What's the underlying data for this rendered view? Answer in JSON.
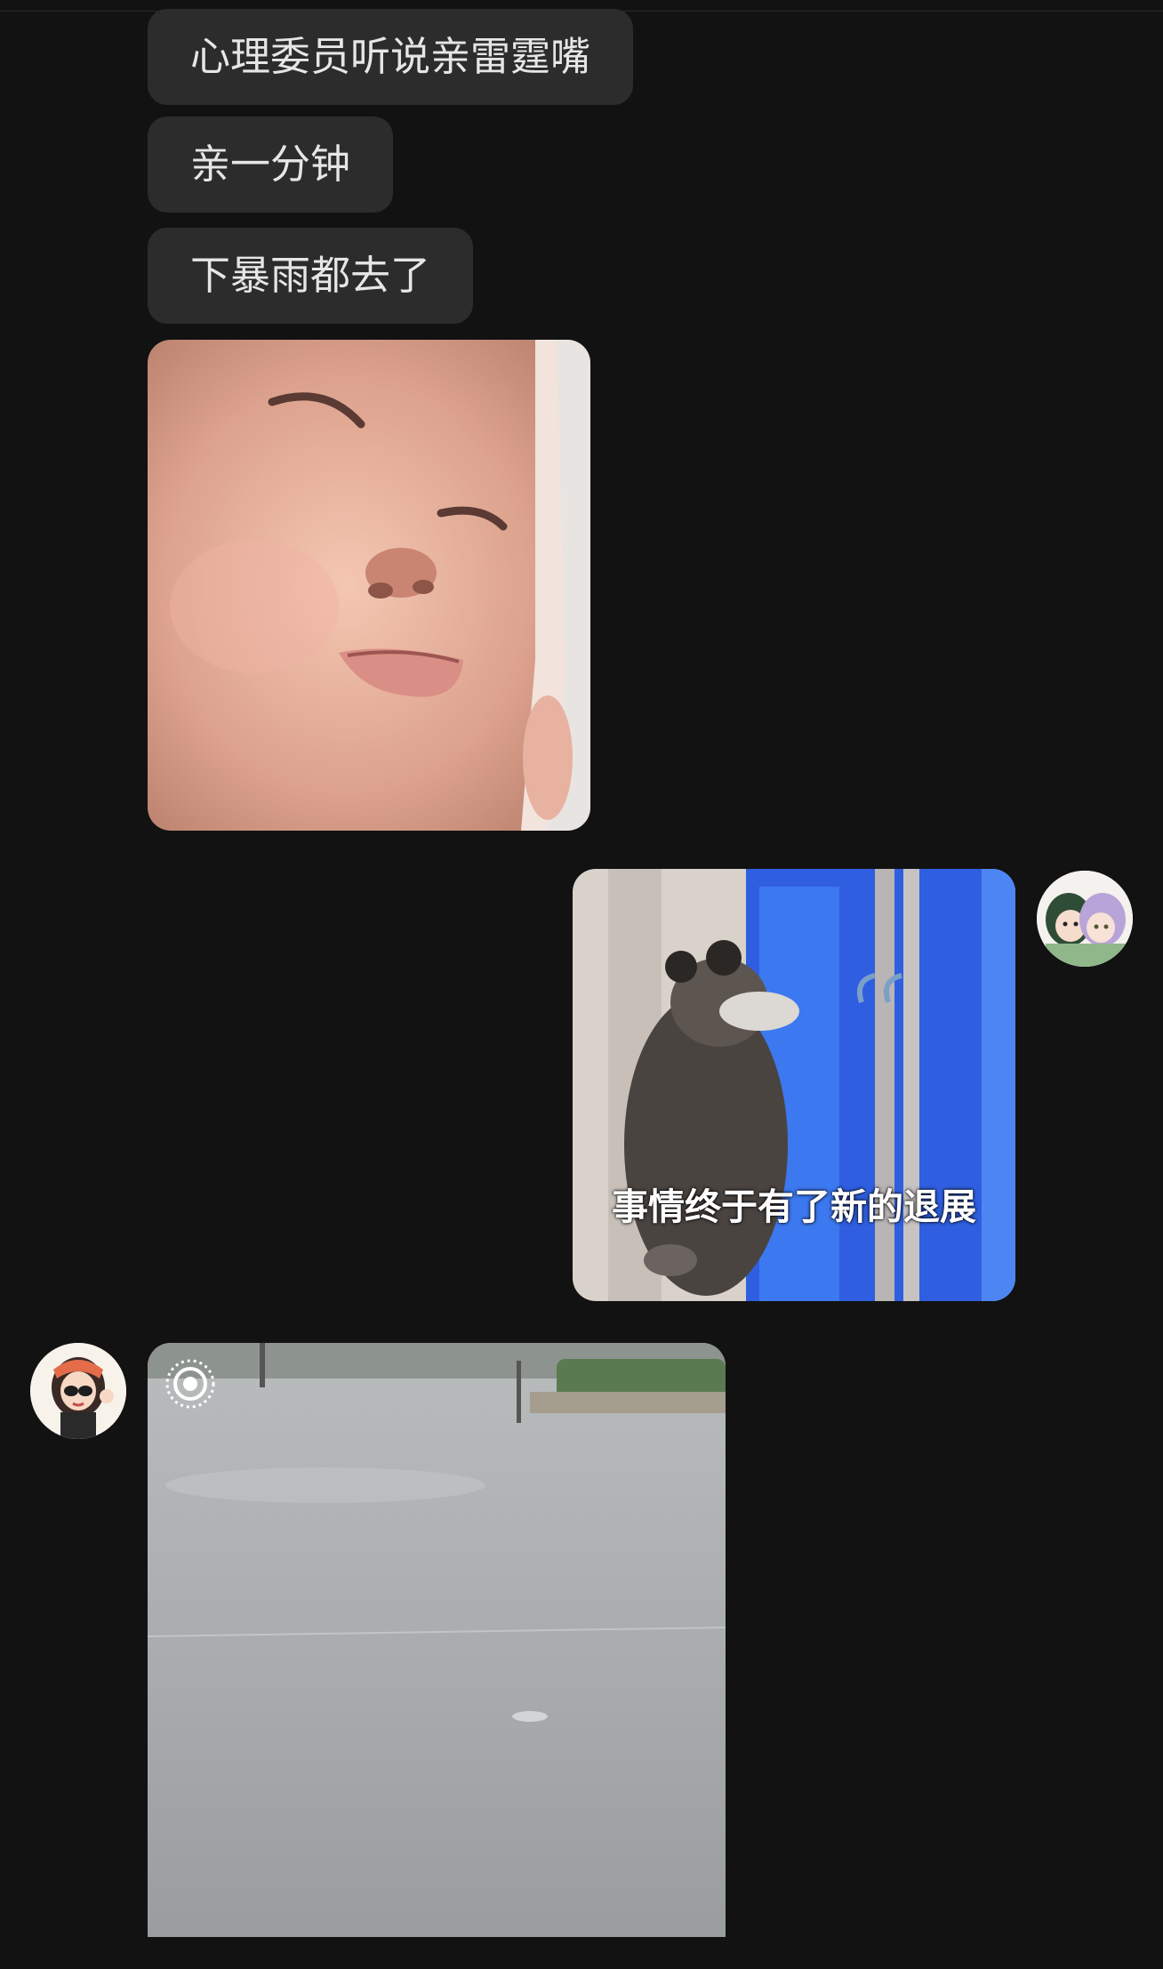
{
  "messages": {
    "received": [
      {
        "text": "心理委员听说亲雷霆嘴"
      },
      {
        "text": "亲一分钟"
      },
      {
        "text": "下暴雨都去了"
      }
    ],
    "sticker_sent_caption": "事情终于有了新的退展"
  },
  "icons": {
    "video_badge": "live-photo-icon"
  }
}
